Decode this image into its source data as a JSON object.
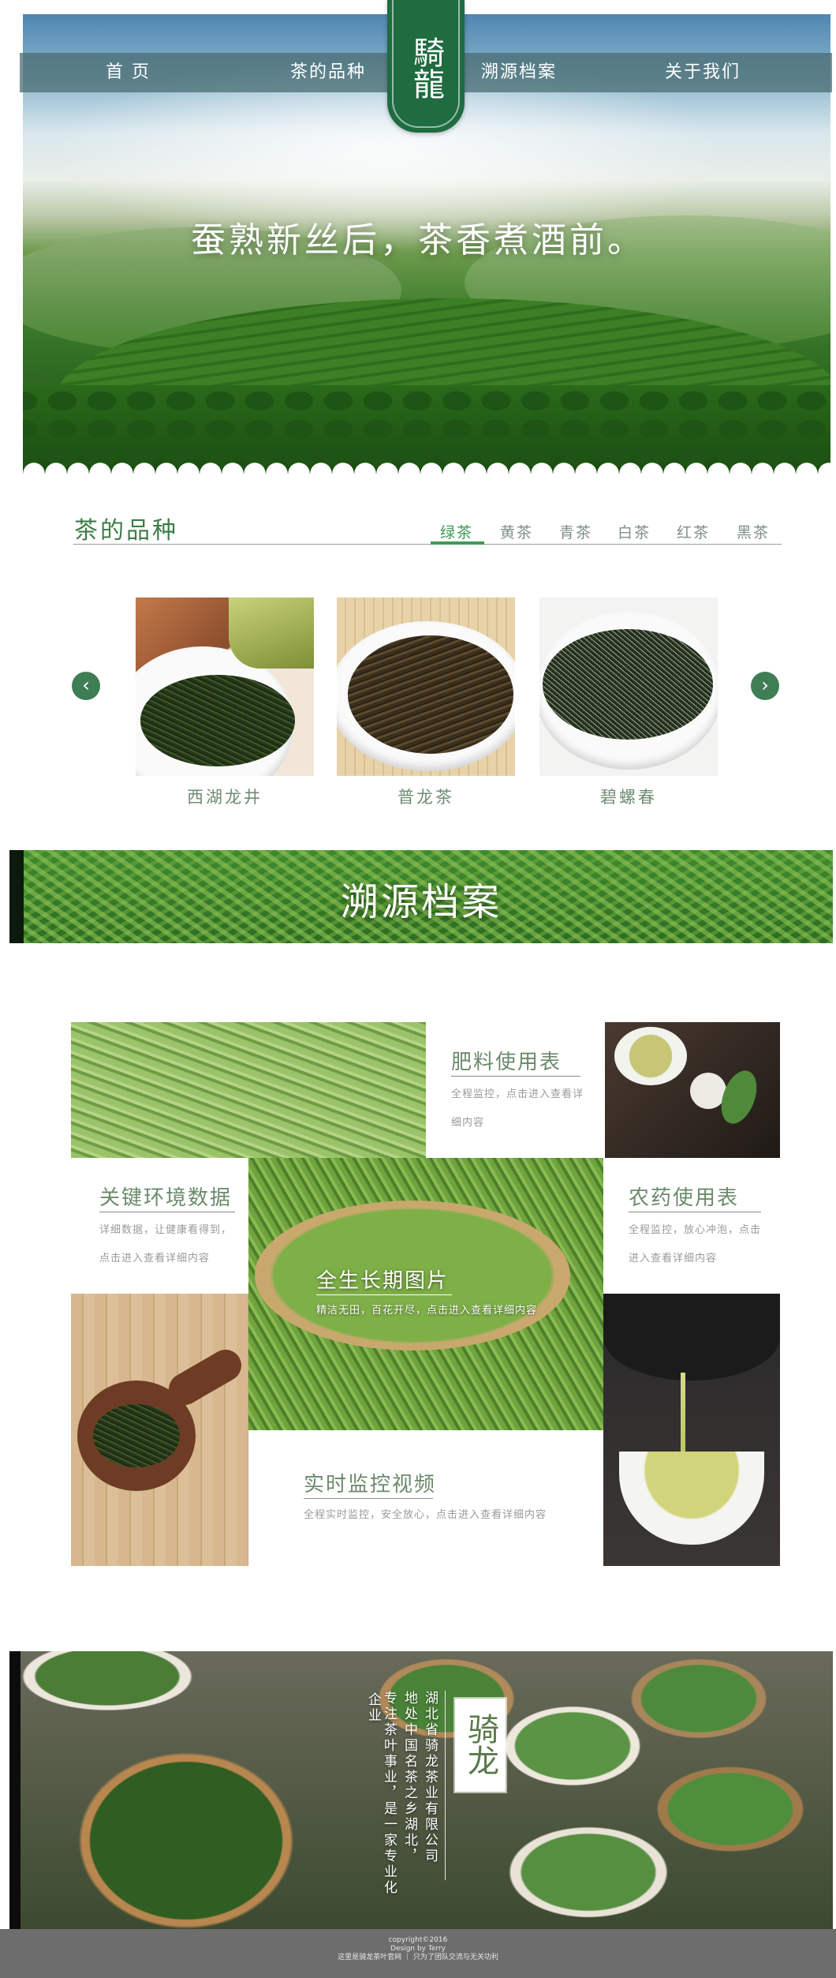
{
  "nav": {
    "items": [
      "首 页",
      "茶的品种",
      "溯源档案",
      "关于我们"
    ],
    "logo_text": "騎龍"
  },
  "hero": {
    "slogan": "蚕熟新丝后，茶香煮酒前。"
  },
  "varieties": {
    "title": "茶的品种",
    "tabs": [
      "绿茶",
      "黄茶",
      "青茶",
      "白茶",
      "红茶",
      "黑茶"
    ],
    "active_tab": "绿茶",
    "prev_icon": "chevron-left-icon",
    "next_icon": "chevron-right-icon",
    "cards": [
      {
        "name": "西湖龙井"
      },
      {
        "name": "普龙茶"
      },
      {
        "name": "碧螺春"
      }
    ]
  },
  "banner": {
    "title": "溯源档案"
  },
  "trace": {
    "fertilizer": {
      "title": "肥料使用表",
      "desc": "全程监控，点击进入查看详细内容"
    },
    "environment": {
      "title": "关键环境数据",
      "desc": "详细数据，让健康看得到，点击进入查看详细内容"
    },
    "growth": {
      "title": "全生长期图片",
      "desc": "精洁无田，百花开尽，点击进入查看详细内容"
    },
    "pesticide": {
      "title": "农药使用表",
      "desc": "全程监控，放心冲泡，点击进入查看详细内容"
    },
    "monitor": {
      "title": "实时监控视频",
      "desc": "全程实时监控，安全放心，点击进入查看详细内容"
    }
  },
  "about": {
    "brand": "骑龙",
    "col1": "湖北省骑龙茶业有限公司",
    "col2": "地处中国名茶之乡湖北，",
    "col3": "专注茶叶事业，是一家专业化",
    "col4": "企业"
  },
  "footer": {
    "line1": "copyright©2016",
    "line2": "Design by Terry",
    "line3": "这里是骑龙茶叶官网 ｜ 只为了团队交流与无关功利"
  },
  "colors": {
    "brand_green": "#1e6c40",
    "accent_green": "#3f9a55",
    "footer_gray": "#6d6d6d"
  }
}
